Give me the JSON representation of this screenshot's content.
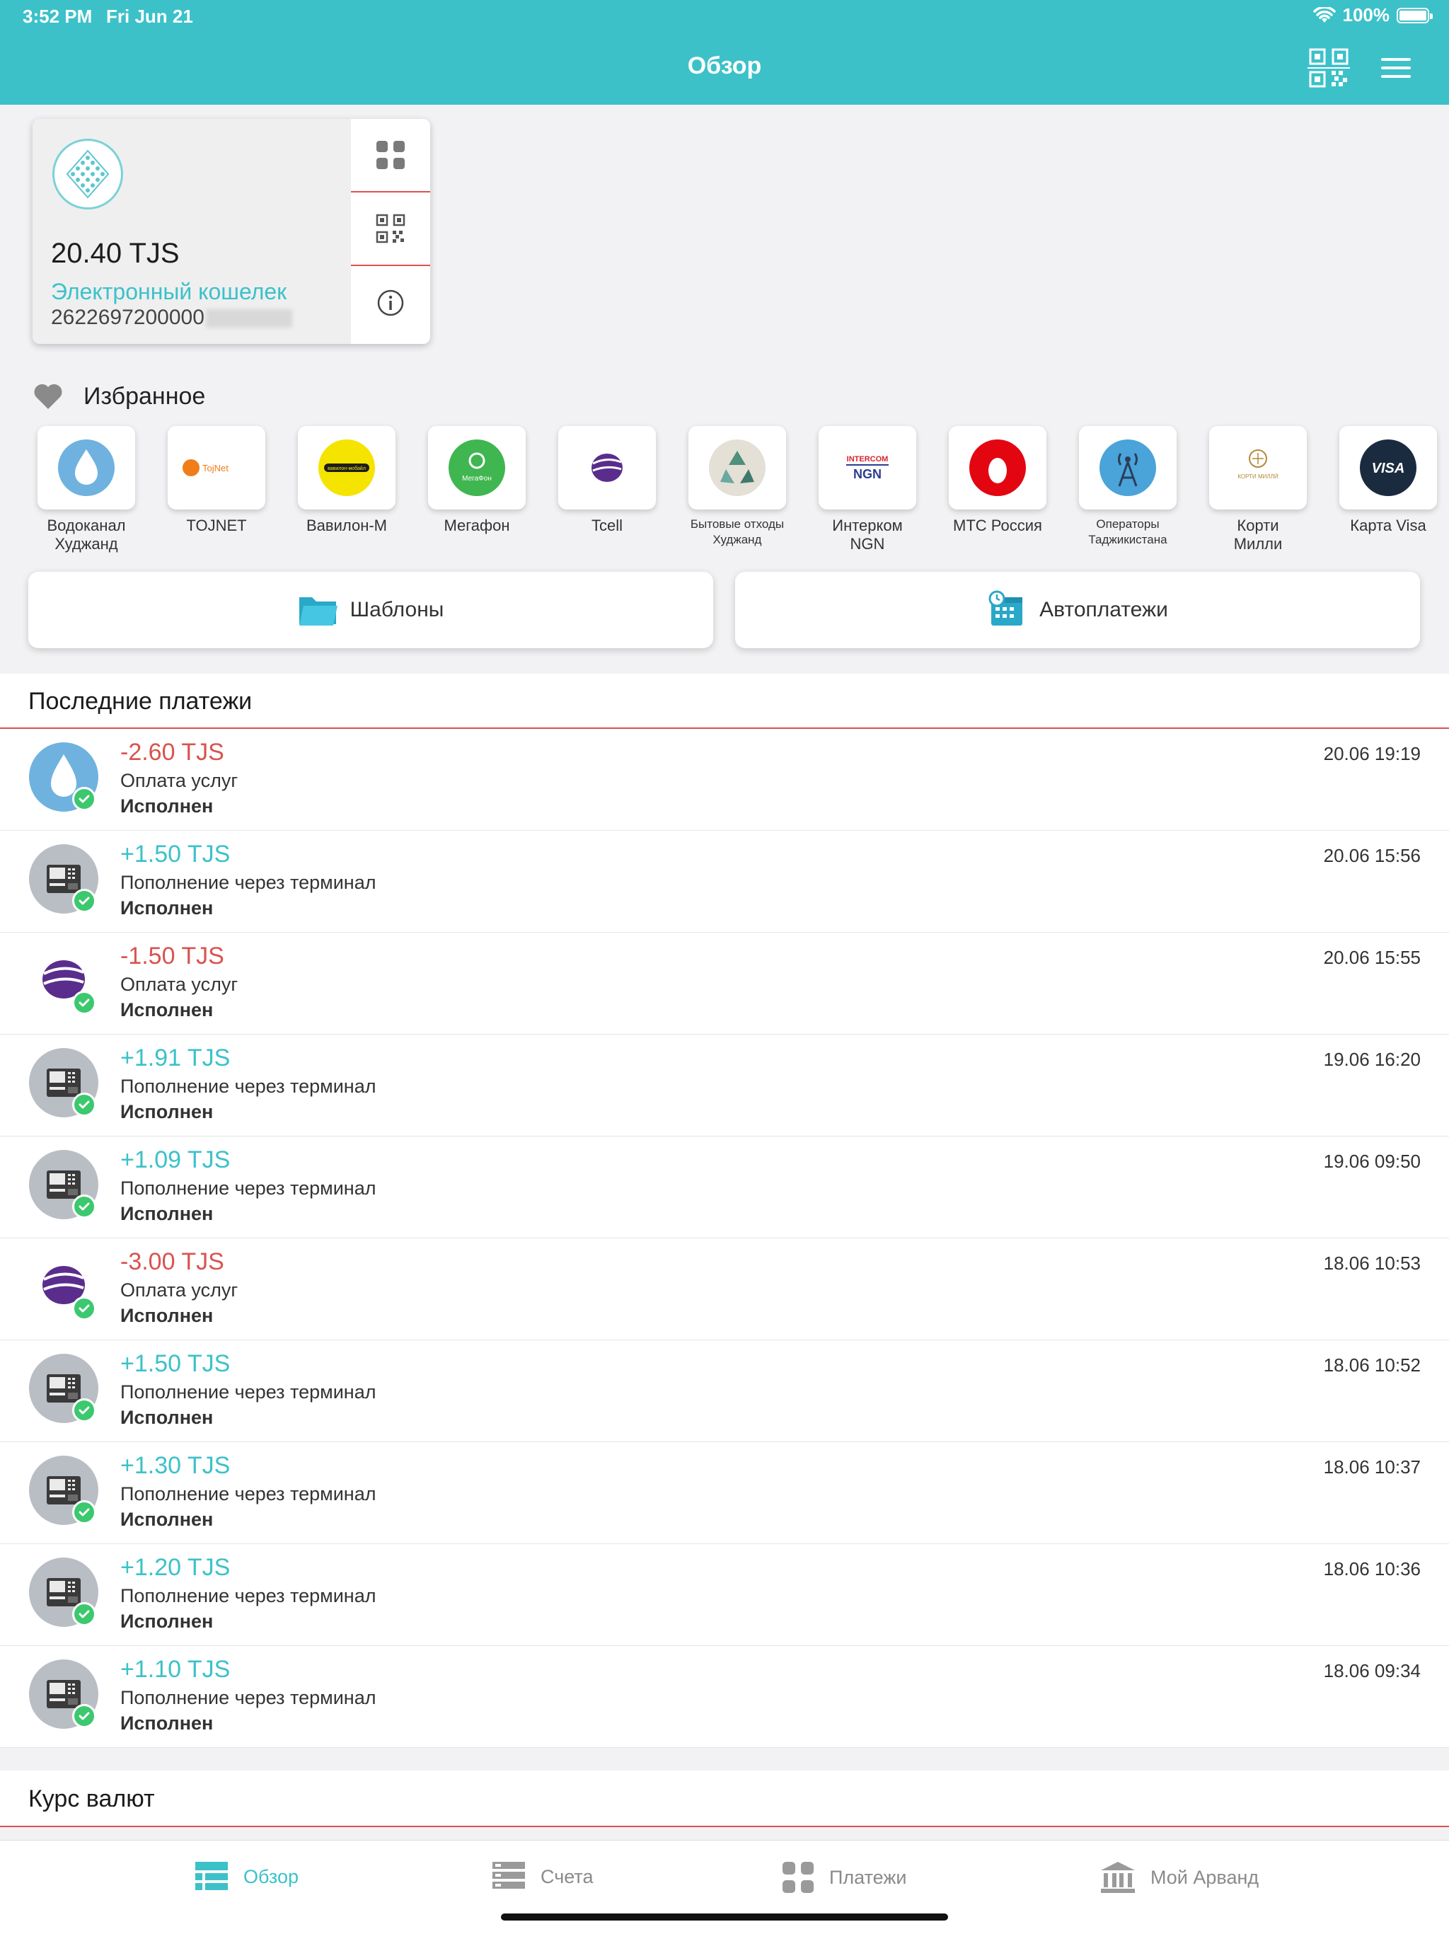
{
  "status_bar": {
    "time": "3:52 PM",
    "date": "Fri Jun 21",
    "battery": "100%"
  },
  "header": {
    "title": "Обзор"
  },
  "wallet": {
    "balance": "20.40 TJS",
    "name": "Электронный кошелек",
    "number": "2622697200000"
  },
  "favorites": {
    "title": "Избранное",
    "items": [
      {
        "label": "Водоканал\nХуджанд",
        "small": false
      },
      {
        "label": "TOJNET",
        "small": false
      },
      {
        "label": "Вавилон-М",
        "small": false
      },
      {
        "label": "Мегафон",
        "small": false
      },
      {
        "label": "Tcell",
        "small": false
      },
      {
        "label": "Бытовые отходы\nХуджанд",
        "small": true
      },
      {
        "label": "Интерком\nNGN",
        "small": false
      },
      {
        "label": "МТС Россия",
        "small": false
      },
      {
        "label": "Операторы\nТаджикистана",
        "small": true
      },
      {
        "label": "Корти\nМилли",
        "small": false
      },
      {
        "label": "Карта Visa",
        "small": false
      }
    ],
    "logo_texts": {
      "tojnet": "TojNet",
      "babilon": "вавилон-мобайл",
      "megafon": "МегаФон",
      "intercom": "INTERCOM",
      "ngn": "NGN",
      "visa": "VISA",
      "korti": "КОРТИ МИЛЛӢ"
    }
  },
  "buttons": {
    "templates": "Шаблоны",
    "autopay": "Автоплатежи"
  },
  "recent": {
    "title": "Последние платежи",
    "items": [
      {
        "icon": "water",
        "amount": "-2.60 TJS",
        "type": "neg",
        "desc": "Оплата услуг",
        "status": "Исполнен",
        "datetime": "20.06 19:19"
      },
      {
        "icon": "atm",
        "amount": "+1.50 TJS",
        "type": "pos",
        "desc": "Пополнение через терминал",
        "status": "Исполнен",
        "datetime": "20.06 15:56"
      },
      {
        "icon": "tcell",
        "amount": "-1.50 TJS",
        "type": "neg",
        "desc": "Оплата услуг",
        "status": "Исполнен",
        "datetime": "20.06 15:55"
      },
      {
        "icon": "atm",
        "amount": "+1.91 TJS",
        "type": "pos",
        "desc": "Пополнение через терминал",
        "status": "Исполнен",
        "datetime": "19.06 16:20"
      },
      {
        "icon": "atm",
        "amount": "+1.09 TJS",
        "type": "pos",
        "desc": "Пополнение через терминал",
        "status": "Исполнен",
        "datetime": "19.06 09:50"
      },
      {
        "icon": "tcell",
        "amount": "-3.00 TJS",
        "type": "neg",
        "desc": "Оплата услуг",
        "status": "Исполнен",
        "datetime": "18.06 10:53"
      },
      {
        "icon": "atm",
        "amount": "+1.50 TJS",
        "type": "pos",
        "desc": "Пополнение через терминал",
        "status": "Исполнен",
        "datetime": "18.06 10:52"
      },
      {
        "icon": "atm",
        "amount": "+1.30 TJS",
        "type": "pos",
        "desc": "Пополнение через терминал",
        "status": "Исполнен",
        "datetime": "18.06 10:37"
      },
      {
        "icon": "atm",
        "amount": "+1.20 TJS",
        "type": "pos",
        "desc": "Пополнение через терминал",
        "status": "Исполнен",
        "datetime": "18.06 10:36"
      },
      {
        "icon": "atm",
        "amount": "+1.10 TJS",
        "type": "pos",
        "desc": "Пополнение через терминал",
        "status": "Исполнен",
        "datetime": "18.06 09:34"
      }
    ]
  },
  "currency": {
    "title": "Курс валют"
  },
  "tabbar": {
    "tabs": [
      {
        "label": "Обзор",
        "active": true
      },
      {
        "label": "Счета",
        "active": false
      },
      {
        "label": "Платежи",
        "active": false
      },
      {
        "label": "Мой Арванд",
        "active": false
      }
    ]
  },
  "colors": {
    "accent": "#3cc1c9",
    "negative": "#d9534f",
    "success": "#3cc86e"
  }
}
